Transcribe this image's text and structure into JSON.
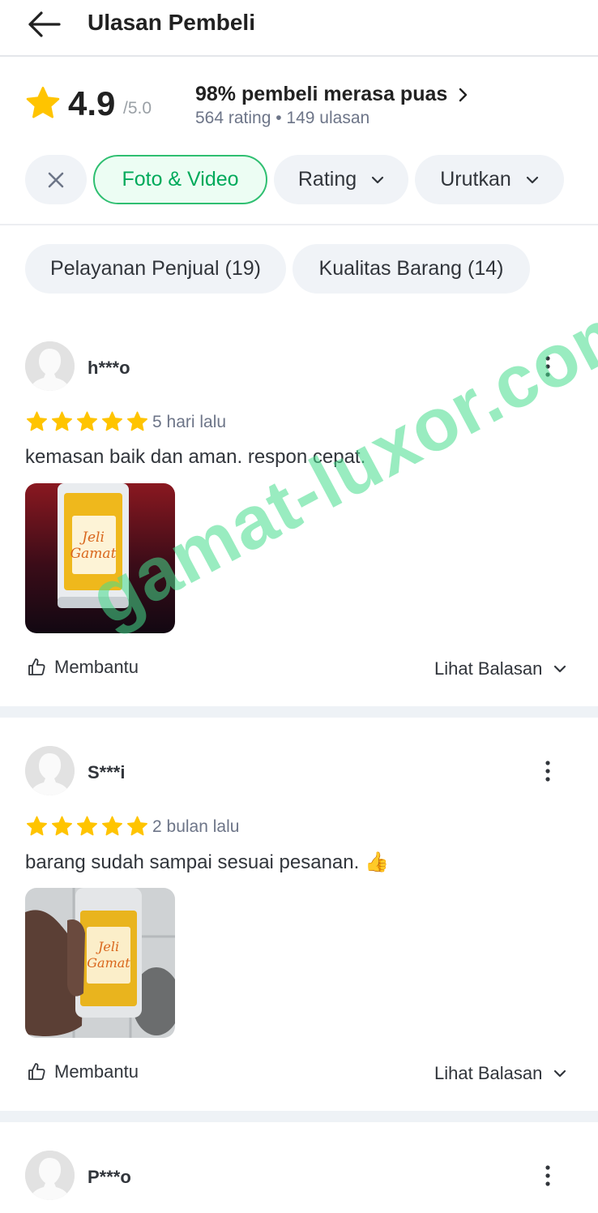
{
  "header": {
    "title": "Ulasan Pembeli"
  },
  "summary": {
    "score": "4.9",
    "score_max": "/5.0",
    "satisfied": "98% pembeli merasa puas",
    "counts": "564 rating • 149 ulasan"
  },
  "filters": {
    "foto_video": "Foto & Video",
    "rating": "Rating",
    "urutkan": "Urutkan"
  },
  "topics": [
    {
      "label": "Pelayanan Penjual (19)"
    },
    {
      "label": "Kualitas Barang (14)"
    }
  ],
  "reviews": [
    {
      "user": "h***o",
      "rating": 5,
      "time": "5 hari lalu",
      "text": "kemasan baik dan aman. respon cepat.",
      "helpful": "Membantu",
      "replies": "Lihat Balasan"
    },
    {
      "user": "S***i",
      "rating": 5,
      "time": "2 bulan lalu",
      "text": "barang sudah sampai sesuai pesanan. 👍",
      "helpful": "Membantu",
      "replies": "Lihat Balasan"
    },
    {
      "user": "P***o"
    }
  ],
  "product_label": {
    "line1": "Jeli",
    "line2": "Gamat"
  },
  "watermark": "gamat-luxor.com",
  "colors": {
    "accent": "#00aa5b",
    "star": "#ffc400",
    "chip_bg": "#f0f3f7",
    "watermark": "#46dc8c"
  }
}
